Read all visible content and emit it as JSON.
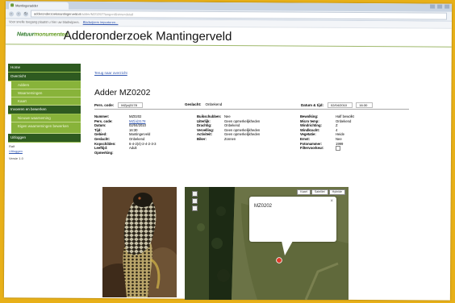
{
  "browser": {
    "tab_title": "Mantingeradder",
    "url_host": "adderonderzoekmantingerveld.nl",
    "url_rest": "/adder/MZ0202?lang=nl&view=detail",
    "bookmarks_text": "Voor snelle toegang plaatst u hier uw bladwijzers.",
    "bookmarks_link": "Bladwijzers importeren..."
  },
  "site": {
    "logo_text_a": "Natuur",
    "logo_text_b": "monumenten",
    "title": "Adderonderzoek Mantingerveld"
  },
  "sidebar": {
    "items": [
      {
        "label": "Home",
        "style": "dark"
      },
      {
        "label": "Overzicht",
        "style": "dark"
      },
      {
        "label": "Adders",
        "style": "light"
      },
      {
        "label": "Waarnemingen",
        "style": "light"
      },
      {
        "label": "Kaart",
        "style": "light"
      },
      {
        "label": "Invoeren en bewerken",
        "style": "dark"
      },
      {
        "label": "Nieuwe waarneming",
        "style": "light"
      },
      {
        "label": "Eigen waarnemingen bewerken",
        "style": "light-tall"
      },
      {
        "label": "Uitloggen",
        "style": "dark"
      }
    ],
    "user": "Ralf",
    "user_link": "Uitloggen",
    "version": "Versie 1.0"
  },
  "main": {
    "back_link": "Terug naar overzicht",
    "title": "Adder MZ0202",
    "summary": {
      "pers_code_label": "Pers. code:",
      "pers_code_value": "MZ(a)3178",
      "geslacht_label": "Geslacht:",
      "geslacht_value": "Onbekend",
      "datum_label": "Datum & tijd:",
      "datum_value": "02/04/2010",
      "tijd_value": "16:30"
    },
    "details": {
      "col1": [
        {
          "label": "Nummer:",
          "value": "MZ0202",
          "link": false
        },
        {
          "label": "Pers. code:",
          "value": "MZ(a)3178",
          "link": true
        },
        {
          "label": "Datum:",
          "value": "02/04/2010",
          "link": false
        },
        {
          "label": "Tijd:",
          "value": "16:30",
          "link": false
        },
        {
          "label": "Gebied:",
          "value": "Mantingerveld",
          "link": false
        },
        {
          "label": "Geslacht:",
          "value": "Onbekend",
          "link": false
        },
        {
          "label": "Kopschilden:",
          "value": "6-4-2(4)-2-4-2-3-3",
          "link": false
        },
        {
          "label": "Leeftijd:",
          "value": "Adult",
          "link": false
        },
        {
          "label": "Opmerking:",
          "value": "",
          "link": false
        }
      ],
      "col2": [
        {
          "label": "Buikschubben:",
          "value": "Nee",
          "link": false
        },
        {
          "label": "Uiterlijk:",
          "value": "Geen opmerkelijkheden",
          "link": false
        },
        {
          "label": "Drachtig:",
          "value": "Onbekend",
          "link": false
        },
        {
          "label": "Vervelling:",
          "value": "Geen opmerkelijkheden",
          "link": false
        },
        {
          "label": "Activiteit:",
          "value": "Geen opmerkelijkheden",
          "link": false
        },
        {
          "label": "Biker:",
          "value": "Zonnen",
          "link": false
        }
      ],
      "col3": [
        {
          "label": "Bewolking:",
          "value": "Half bewolkt",
          "checkbox": false
        },
        {
          "label": "Micro temp:",
          "value": "Onbekend",
          "checkbox": false
        },
        {
          "label": "Windrichting:",
          "value": "Z",
          "checkbox": false
        },
        {
          "label": "Windkracht:",
          "value": "4",
          "checkbox": false
        },
        {
          "label": "Vegetatie:",
          "value": "Heide",
          "checkbox": false
        },
        {
          "label": "Ernst:",
          "value": "Nee",
          "checkbox": false
        },
        {
          "label": "Fotonummer:",
          "value": "1999",
          "checkbox": false
        },
        {
          "label": "Filtervoorkeur:",
          "value": "",
          "checkbox": true
        }
      ]
    }
  },
  "map": {
    "controls": [
      "Kaart",
      "Satelliet",
      "Hybride"
    ],
    "popup_text": "MZ0202",
    "popup_close": "×"
  }
}
